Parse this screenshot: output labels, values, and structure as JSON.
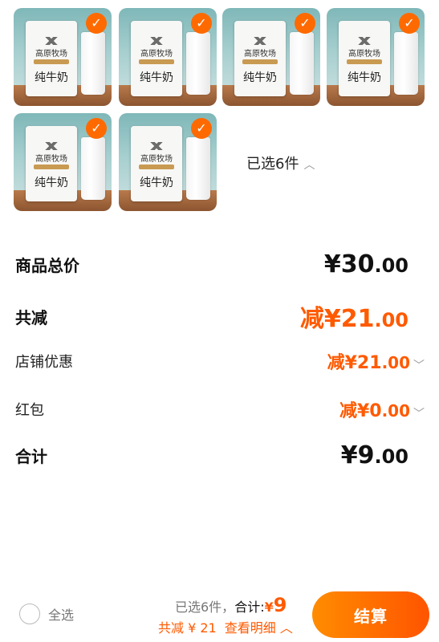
{
  "products": [
    {
      "name": "纯牛奶",
      "brand": "高原牧场",
      "checked": true
    },
    {
      "name": "纯牛奶",
      "brand": "高原牧场",
      "checked": true
    },
    {
      "name": "纯牛奶",
      "brand": "高原牧场",
      "checked": true
    },
    {
      "name": "纯牛奶",
      "brand": "高原牧场",
      "checked": true
    },
    {
      "name": "纯牛奶",
      "brand": "高原牧场",
      "checked": true
    },
    {
      "name": "纯牛奶",
      "brand": "高原牧场",
      "checked": true
    }
  ],
  "selected_count_label": "已选6件",
  "summary": {
    "total_label": "商品总价",
    "total_int": "¥30",
    "total_dec": ".00",
    "reduction_label": "共减",
    "reduction_int": "减¥21",
    "reduction_dec": ".00",
    "shop_label": "店铺优惠",
    "shop_int": "减¥21",
    "shop_dec": ".00",
    "redpacket_label": "红包",
    "redpacket_int": "减¥0",
    "redpacket_dec": ".00",
    "sum_label": "合计",
    "sum_int": "¥9",
    "sum_dec": ".00"
  },
  "footer": {
    "select_all": "全选",
    "selected_text": "已选6件，",
    "total_text": "合计:",
    "currency": "¥",
    "total_value": "9",
    "reduction_text": "共减 ¥ 21",
    "detail_text": "查看明细",
    "checkout": "结算"
  },
  "colors": {
    "accent": "#ff5a00",
    "check": "#ff6a00"
  }
}
